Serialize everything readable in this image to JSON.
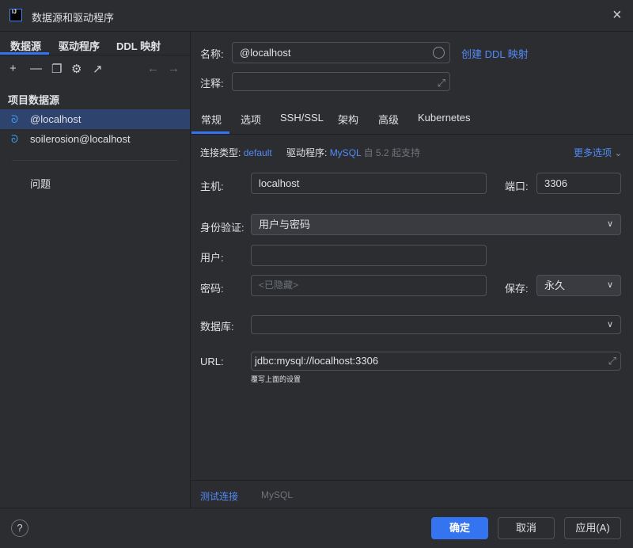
{
  "window": {
    "title": "数据源和驱动程序",
    "logo": "IJ"
  },
  "left": {
    "tabs": [
      "数据源",
      "驱动程序",
      "DDL 映射"
    ],
    "section": "项目数据源",
    "items": [
      "@localhost",
      "soilerosion@localhost"
    ],
    "problems": "问题"
  },
  "header": {
    "name_label": "名称:",
    "name_value": "@localhost",
    "create_ddl": "创建 DDL 映射",
    "comment_label": "注释:"
  },
  "tabs": [
    "常规",
    "选项",
    "SSH/SSL",
    "架构",
    "高级",
    "Kubernetes"
  ],
  "conn": {
    "type_label": "连接类型:",
    "type_value": "default",
    "driver_label": "驱动程序:",
    "driver_value": "MySQL",
    "driver_note": "自 5.2 起支持",
    "more": "更多选项"
  },
  "form": {
    "host_label": "主机:",
    "host": "localhost",
    "port_label": "端口:",
    "port": "3306",
    "auth_label": "身份验证:",
    "auth": "用户与密码",
    "user_label": "用户:",
    "user": "",
    "password_label": "密码:",
    "password_placeholder": "<已隐藏>",
    "save_label": "保存:",
    "save": "永久",
    "db_label": "数据库:",
    "db": "",
    "url_label": "URL:",
    "url": "jdbc:mysql://localhost:3306",
    "url_hint": "覆写上面的设置"
  },
  "bottom": {
    "test": "测试连接",
    "driver": "MySQL"
  },
  "footer": {
    "help": "?",
    "ok": "确定",
    "cancel": "取消",
    "apply": "应用(A)"
  }
}
